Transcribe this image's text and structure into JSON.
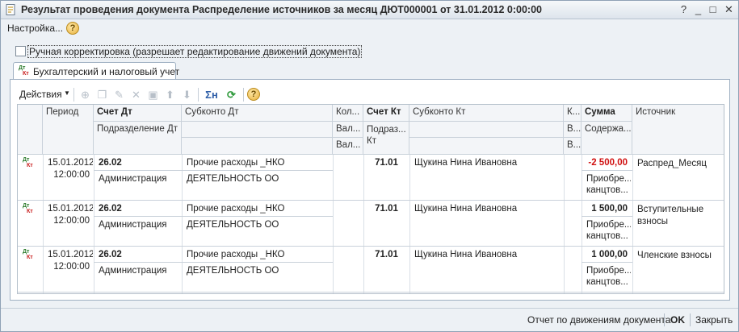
{
  "window": {
    "title": "Результат проведения документа Распределение источников за месяц ДЮТ000001 от 31.01.2012 0:00:00",
    "buttons": {
      "help": "?",
      "minimize": "_",
      "maximize": "□",
      "close": "✕"
    }
  },
  "menubar": {
    "settings": "Настройка...",
    "help": "?"
  },
  "manual_edit": {
    "label": "Ручная корректировка (разрешает редактирование движений документа)",
    "checked": false
  },
  "tab": {
    "label": "Бухгалтерский и налоговый учет",
    "icon_top": "Дт",
    "icon_bottom": "Кт"
  },
  "toolbar": {
    "actions": "Действия",
    "icons": [
      "add-icon",
      "copy-icon",
      "edit-icon",
      "delete-icon",
      "save-icon",
      "move-up-icon",
      "move-down-icon",
      "sum-icon",
      "refresh-icon",
      "help-icon"
    ],
    "sum_glyph": "Σн",
    "refresh_glyph": "⟳",
    "help_glyph": "?"
  },
  "grid": {
    "headers": {
      "period": "Период",
      "schet_dt": "Счет Дт",
      "podrazd_dt": "Подразделение Дт",
      "subkonto_dt": "Субконто Дт",
      "kol_dt": "Кол...",
      "val_dt_1": "Вал...",
      "val_dt_2": "Вал...",
      "schet_kt": "Счет Кт",
      "podrazd_kt": "Подраз... Кт",
      "subkonto_kt": "Субконто Кт",
      "k_kt": "К...",
      "v_kt_1": "В...",
      "v_kt_2": "В...",
      "summa": "Сумма",
      "soderzh": "Содержа...",
      "istochnik": "Источник"
    },
    "rows": [
      {
        "icon_top": "Дт",
        "icon_bottom": "Кт",
        "date": "15.01.2012",
        "time": "12:00:00",
        "schet_dt": "26.02",
        "podrazd_dt": "Администрация",
        "subkonto_dt_1": "Прочие расходы _НКО",
        "subkonto_dt_2": "ДЕЯТЕЛЬНОСТЬ ОО",
        "schet_kt": "71.01",
        "subkonto_kt": "Щукина Нина Ивановна",
        "summa": "-2 500,00",
        "summa_negative": true,
        "soderzh_1": "Приобре...",
        "soderzh_2": "канцтов...",
        "istochnik": "Распред_Месяц"
      },
      {
        "icon_top": "Дт",
        "icon_bottom": "Кт",
        "date": "15.01.2012",
        "time": "12:00:00",
        "schet_dt": "26.02",
        "podrazd_dt": "Администрация",
        "subkonto_dt_1": "Прочие расходы _НКО",
        "subkonto_dt_2": "ДЕЯТЕЛЬНОСТЬ ОО",
        "schet_kt": "71.01",
        "subkonto_kt": "Щукина Нина Ивановна",
        "summa": "1 500,00",
        "summa_negative": false,
        "soderzh_1": "Приобре...",
        "soderzh_2": "канцтов...",
        "istochnik": "Вступительные взносы"
      },
      {
        "icon_top": "Дт",
        "icon_bottom": "Кт",
        "date": "15.01.2012",
        "time": "12:00:00",
        "schet_dt": "26.02",
        "podrazd_dt": "Администрация",
        "subkonto_dt_1": "Прочие расходы _НКО",
        "subkonto_dt_2": "ДЕЯТЕЛЬНОСТЬ ОО",
        "schet_kt": "71.01",
        "subkonto_kt": "Щукина Нина Ивановна",
        "summa": "1 000,00",
        "summa_negative": false,
        "soderzh_1": "Приобре...",
        "soderzh_2": "канцтов...",
        "istochnik": "Членские взносы"
      }
    ]
  },
  "bottombar": {
    "report": "Отчет по движениям документа",
    "ok": "OK",
    "close": "Закрыть"
  },
  "colors": {
    "accent": "#2f5fa8",
    "negative": "#d01010",
    "window_bg": "#edf1f5"
  }
}
